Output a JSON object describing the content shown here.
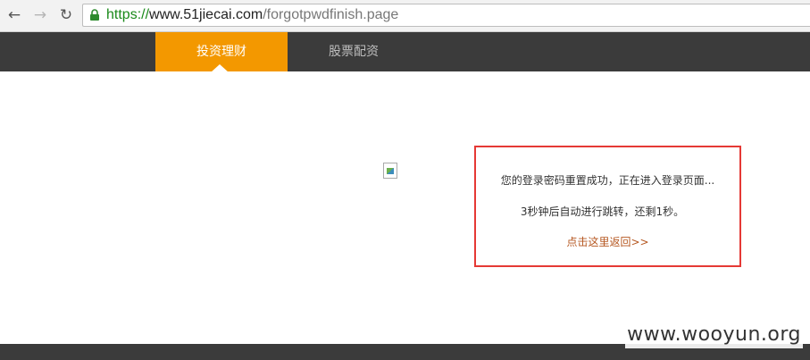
{
  "browser": {
    "back_icon": "back-arrow-icon",
    "forward_icon": "forward-arrow-icon",
    "reload_icon": "reload-icon",
    "url_scheme": "https://",
    "url_host": "www.51jiecai.com",
    "url_path": "/forgotpwdfinish.page"
  },
  "site_nav": {
    "tabs": [
      {
        "label": "投资理财",
        "active": true
      },
      {
        "label": "股票配资",
        "active": false
      }
    ]
  },
  "message": {
    "line1": "您的登录密码重置成功，正在进入登录页面...",
    "line2": "3秒钟后自动进行跳转，还剩1秒。",
    "link": "点击这里返回>>"
  },
  "watermark": "www.wooyun.org",
  "colors": {
    "nav_bg": "#3b3b3b",
    "active_tab": "#f39800",
    "highlight_border": "#e53935",
    "link": "#b5561f",
    "secure_scheme": "#1a8a1a"
  }
}
